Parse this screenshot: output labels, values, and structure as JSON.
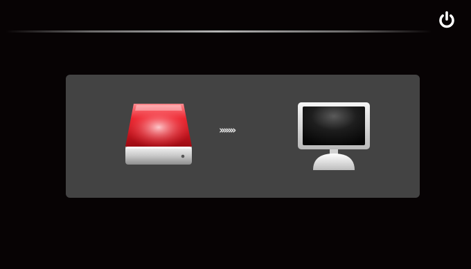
{
  "header": {
    "power_icon": "power-icon"
  },
  "transfer": {
    "source_icon": "external-hard-drive-icon",
    "arrows_text": "›››››››",
    "target_icon": "computer-monitor-icon"
  },
  "colors": {
    "background": "#070304",
    "panel": "#434343",
    "drive_accent": "#d6141e"
  }
}
